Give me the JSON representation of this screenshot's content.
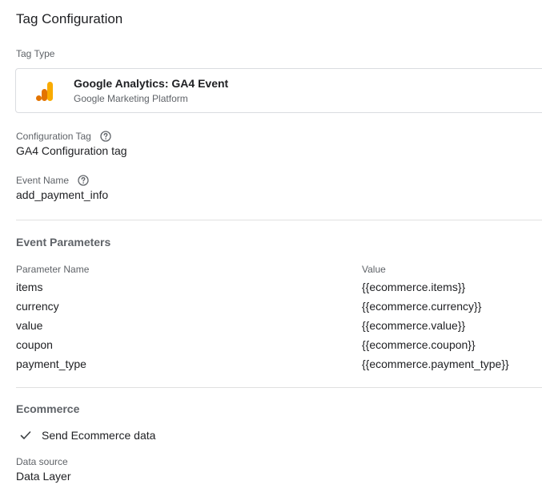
{
  "page": {
    "title": "Tag Configuration"
  },
  "tag_type": {
    "label": "Tag Type",
    "name": "Google Analytics: GA4 Event",
    "platform": "Google Marketing Platform",
    "logo_icon": "google-analytics-logo",
    "logo_colors": [
      "#F9AB00",
      "#E37400"
    ]
  },
  "configuration_tag": {
    "label": "Configuration Tag",
    "value": "GA4 Configuration tag",
    "help_icon": "help-circle-icon"
  },
  "event_name": {
    "label": "Event Name",
    "value": "add_payment_info",
    "help_icon": "help-circle-icon"
  },
  "event_parameters": {
    "title": "Event Parameters",
    "column_name": "Parameter Name",
    "column_value": "Value",
    "rows": [
      {
        "name": "items",
        "value": "{{ecommerce.items}}"
      },
      {
        "name": "currency",
        "value": "{{ecommerce.currency}}"
      },
      {
        "name": "value",
        "value": "{{ecommerce.value}}"
      },
      {
        "name": "coupon",
        "value": "{{ecommerce.coupon}}"
      },
      {
        "name": "payment_type",
        "value": "{{ecommerce.payment_type}}"
      }
    ]
  },
  "ecommerce": {
    "title": "Ecommerce",
    "send_label": "Send Ecommerce data",
    "send_checked": true,
    "data_source_label": "Data source",
    "data_source_value": "Data Layer"
  }
}
